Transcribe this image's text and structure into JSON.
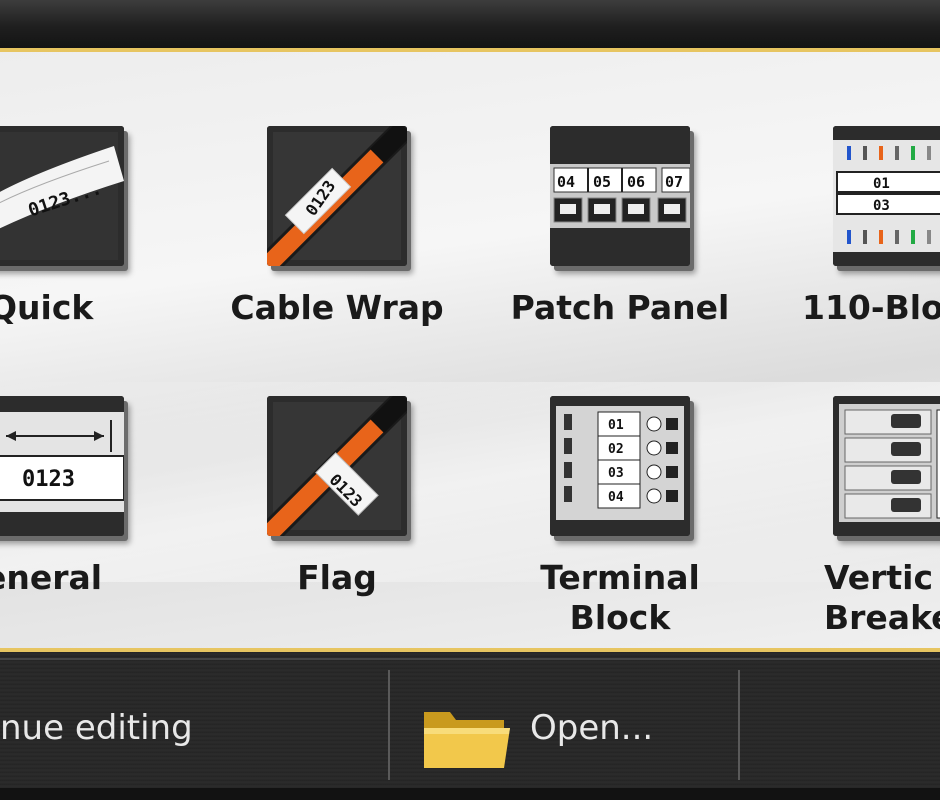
{
  "templates": [
    {
      "id": "quick",
      "label": "Quick",
      "icon": "quick-label-icon"
    },
    {
      "id": "cable-wrap",
      "label": "Cable Wrap",
      "icon": "cable-wrap-icon"
    },
    {
      "id": "patch-panel",
      "label": "Patch Panel",
      "icon": "patch-panel-icon"
    },
    {
      "id": "110-block",
      "label": "110-Blo",
      "icon": "110-block-icon"
    },
    {
      "id": "general",
      "label": "eneral",
      "icon": "general-label-icon"
    },
    {
      "id": "flag",
      "label": "Flag",
      "icon": "flag-label-icon"
    },
    {
      "id": "terminal-block",
      "label_line1": "Terminal",
      "label_line2": "Block",
      "icon": "terminal-block-icon"
    },
    {
      "id": "vertical-breaker",
      "label_line1": "Vertic",
      "label_line2": "Breake",
      "icon": "vertical-breaker-icon"
    }
  ],
  "icon_text": {
    "quick": "0123...",
    "cable_wrap": "0123",
    "patch_ports": [
      "04",
      "05",
      "06",
      "07"
    ],
    "block_110": [
      "01",
      "03"
    ],
    "general": "0123",
    "flag": "0123",
    "terminal": [
      "01",
      "02",
      "03",
      "04"
    ]
  },
  "bottom_bar": {
    "continue_label": "nue editing",
    "open_label": "Open...",
    "folder_icon": "folder-icon"
  },
  "colors": {
    "panel_border": "#e7c561",
    "wire_orange": "#e8641a",
    "folder_yellow": "#f2c84b"
  }
}
